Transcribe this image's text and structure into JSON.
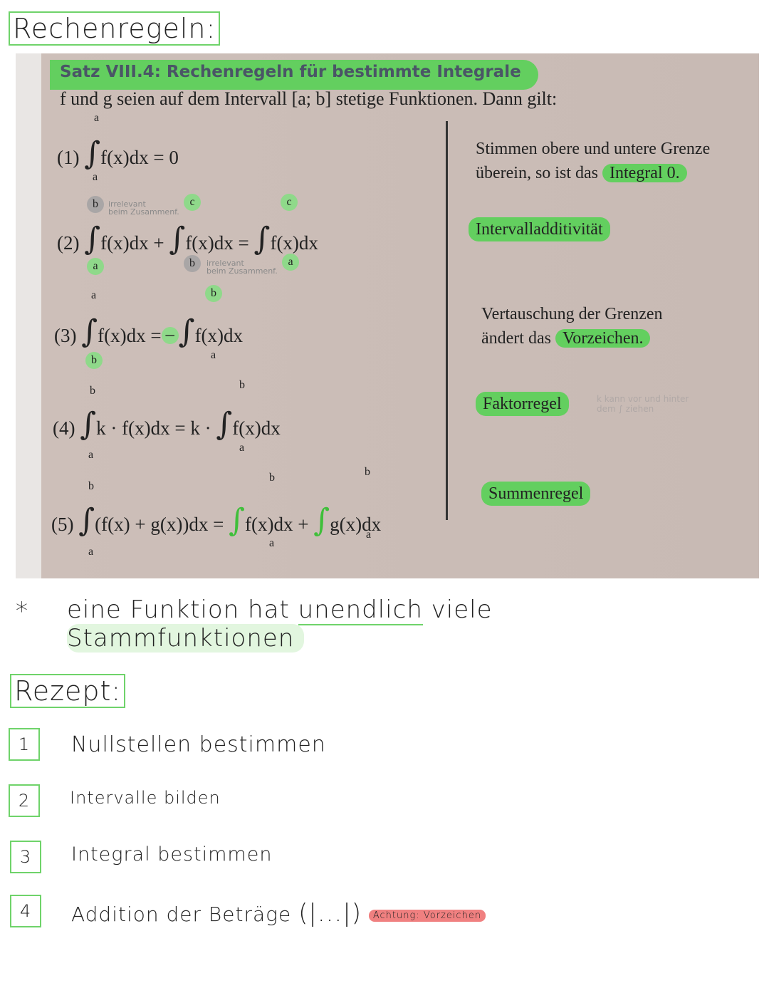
{
  "heading": "Rechenregeln:",
  "photo": {
    "satz_title": "Satz VIII.4: Rechenregeln für bestimmte Integrale",
    "intro": "f und g seien auf dem Intervall [a; b] stetige Funktionen. Dann gilt:",
    "rules": [
      {
        "num": "(1)",
        "formula": "f(x)dx = 0",
        "upper": "a",
        "lower": "a",
        "desc_a": "Stimmen obere und untere Grenze",
        "desc_b": "überein, so ist das ",
        "desc_hl": "Integral 0."
      },
      {
        "num": "(2)",
        "t1": "f(x)dx +",
        "t2": "f(x)dx =",
        "t3": "f(x)dx",
        "b": "b",
        "a": "a",
        "c": "c",
        "note": "irrelevant",
        "note2": "beim Zusammenf.",
        "label": "Intervalladditivität"
      },
      {
        "num": "(3)",
        "t1": "f(x)dx =",
        "minus": "−",
        "t2": "f(x)dx",
        "a": "a",
        "b": "b",
        "desc_a": "Vertauschung der Grenzen",
        "desc_b": "ändert das ",
        "desc_hl": "Vorzeichen."
      },
      {
        "num": "(4)",
        "t1": "k · f(x)dx = k ·",
        "t2": "f(x)dx",
        "a": "a",
        "b": "b",
        "label": "Faktorregel",
        "faint_note": "k kann vor und hinter dem ∫ ziehen"
      },
      {
        "num": "(5)",
        "t1": "(f(x) + g(x))dx =",
        "t2": "f(x)dx +",
        "t3": "g(x)dx",
        "a": "a",
        "b": "b",
        "label": "Summenregel"
      }
    ]
  },
  "note": {
    "bullet": "*",
    "line1a": "eine Funktion hat ",
    "line1u": "unendlich",
    "line1b": " viele",
    "line2": "Stammfunktionen"
  },
  "rezept": {
    "title": "Rezept:",
    "steps": [
      {
        "n": "1",
        "text": "Nullstellen bestimmen"
      },
      {
        "n": "2",
        "text": "Intervalle bilden"
      },
      {
        "n": "3",
        "text": "Integral bestimmen"
      },
      {
        "n": "4",
        "text": "Addition der Beträge",
        "abs": "(|...|)",
        "warning": "Achtung: Vorzeichen"
      }
    ]
  },
  "colors": {
    "highlight": "#63cf5f",
    "box": "#6fd36a",
    "warning": "#f08080"
  }
}
